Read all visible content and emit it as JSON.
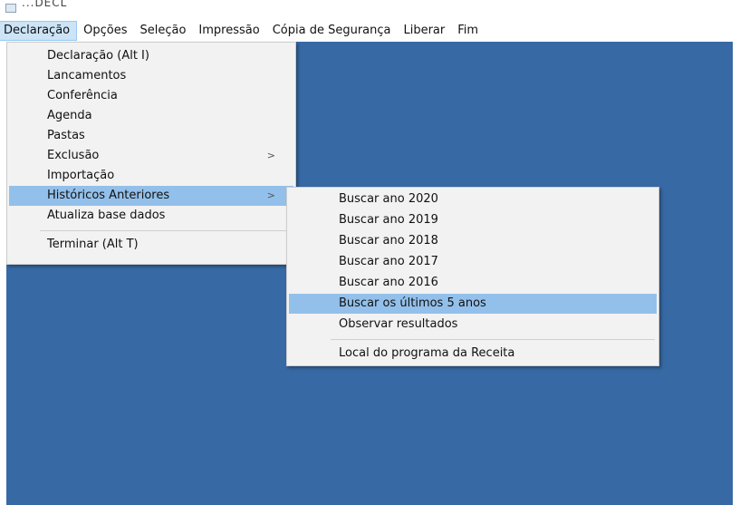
{
  "window": {
    "title": "...DECL"
  },
  "menubar": {
    "items": [
      {
        "label": "Declaração"
      },
      {
        "label": "Opções"
      },
      {
        "label": "Seleção"
      },
      {
        "label": "Impressão"
      },
      {
        "label": "Cópia de Segurança"
      },
      {
        "label": "Liberar"
      },
      {
        "label": "Fim"
      }
    ],
    "active_index": 0
  },
  "declaracao_menu": {
    "items": [
      {
        "label": "Declaração (Alt I)"
      },
      {
        "label": "Lancamentos"
      },
      {
        "label": "Conferência"
      },
      {
        "label": "Agenda"
      },
      {
        "label": "Pastas"
      },
      {
        "label": "Exclusão",
        "submenu_arrow": ">"
      },
      {
        "label": "Importação"
      },
      {
        "label": "Históricos Anteriores",
        "submenu_arrow": ">"
      },
      {
        "label": "Atualiza base dados"
      },
      {
        "label": "Terminar (Alt T)"
      }
    ],
    "highlighted_index": 7
  },
  "historicos_submenu": {
    "items": [
      {
        "label": "Buscar ano 2020"
      },
      {
        "label": "Buscar ano 2019"
      },
      {
        "label": "Buscar ano 2018"
      },
      {
        "label": "Buscar ano 2017"
      },
      {
        "label": "Buscar ano 2016"
      },
      {
        "label": "Buscar os últimos 5 anos"
      },
      {
        "label": "Observar resultados"
      },
      {
        "label": "Local do programa da Receita"
      }
    ],
    "highlighted_index": 5
  },
  "colors": {
    "workspace": "#3769a4",
    "menu_background": "#f2f2f2",
    "highlight": "#93c0ea",
    "menubar_active": "#cce4f7"
  }
}
